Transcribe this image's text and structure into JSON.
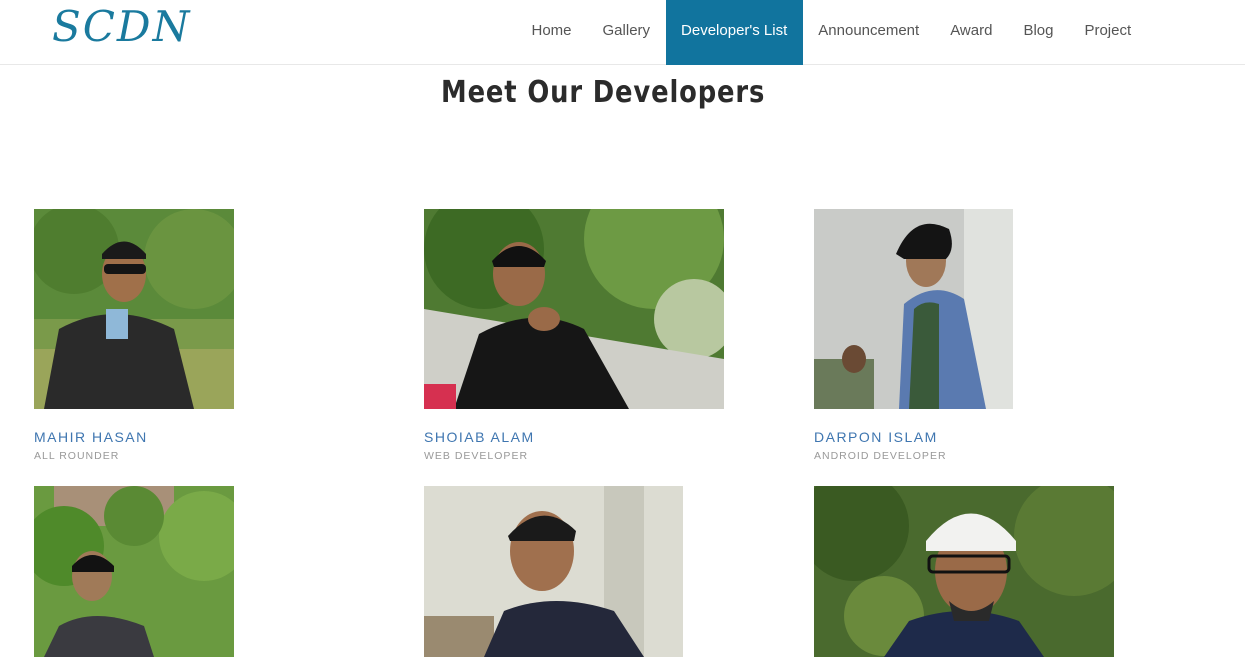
{
  "brand": {
    "logo_text": "SCDN"
  },
  "nav": {
    "items": [
      {
        "label": "Home"
      },
      {
        "label": "Gallery"
      },
      {
        "label": "Developer's List",
        "active": true
      },
      {
        "label": "Announcement"
      },
      {
        "label": "Award"
      },
      {
        "label": "Blog"
      },
      {
        "label": "Project"
      }
    ]
  },
  "page": {
    "title": "Meet Our Developers"
  },
  "developers": [
    {
      "name": "MAHIR HASAN",
      "role": "ALL ROUNDER"
    },
    {
      "name": "SHOIAB ALAM",
      "role": "WEB DEVELOPER"
    },
    {
      "name": "DARPON ISLAM",
      "role": "ANDROID DEVELOPER"
    },
    {
      "name": "",
      "role": ""
    },
    {
      "name": "",
      "role": ""
    },
    {
      "name": "",
      "role": ""
    }
  ],
  "colors": {
    "accent": "#11749e",
    "name_link": "#3f76b0",
    "role_text": "#999999"
  }
}
